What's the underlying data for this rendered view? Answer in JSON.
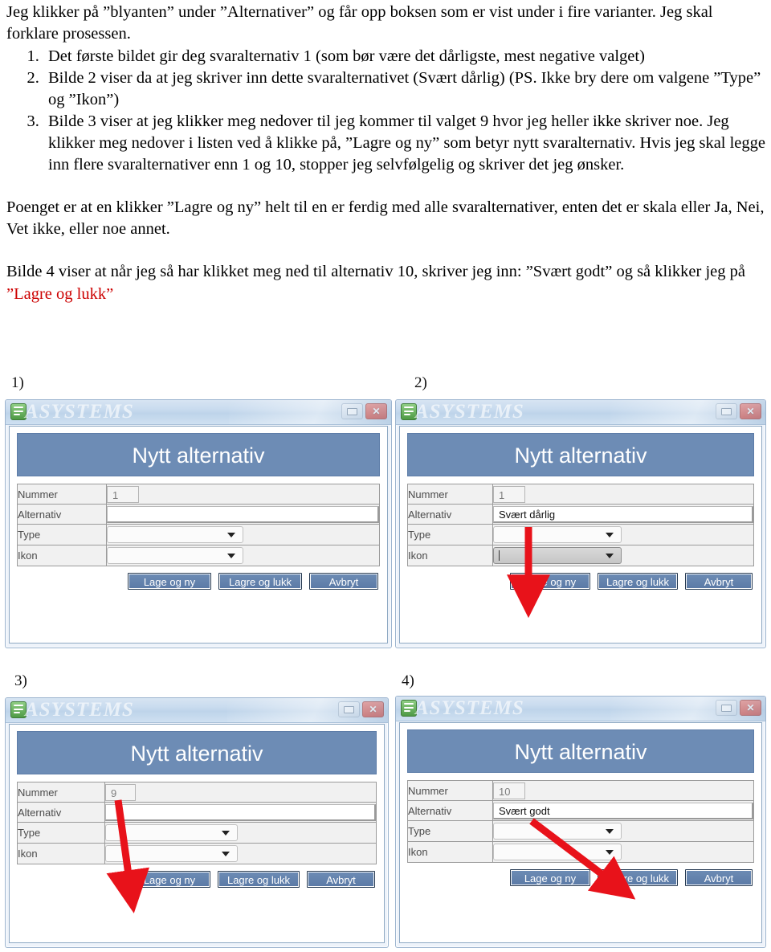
{
  "document": {
    "intro": "Jeg klikker på ”blyanten” under ”Alternativer” og får opp boksen som er vist under i fire varianter. Jeg skal forklare prosessen.",
    "steps": [
      "Det første bildet gir deg svaralternativ 1 (som bør være det dårligste, mest negative valget)",
      "Bilde 2 viser da at jeg skriver inn dette svaralternativet (Svært dårlig) (PS. Ikke bry dere om valgene ”Type” og ”Ikon”)",
      "Bilde 3 viser at jeg klikker meg nedover til jeg kommer til valget 9 hvor jeg heller ikke skriver noe. Jeg klikker meg nedover i listen ved å klikke på, ”Lagre og ny” som betyr nytt svaralternativ. Hvis jeg skal legge inn flere svaralternativer enn 1 og 10, stopper jeg selvfølgelig og skriver det jeg ønsker."
    ],
    "paragraph2": "Poenget er at en klikker ”Lagre og ny” helt til en er ferdig med alle svaralternativer, enten det er skala eller Ja, Nei, Vet ikke,  eller noe annet.",
    "paragraph3_pre": "Bilde 4 viser at når jeg så har klikket meg ned til alternativ 10, skriver jeg inn: ”Svært godt” og så klikker jeg på ",
    "paragraph3_red": "”Lagre og lukk”"
  },
  "captions": {
    "fig1": "1)",
    "fig2": "2)",
    "fig3": "3)",
    "fig4": "4)"
  },
  "dialog_common": {
    "watermark": "ASYSTEMS",
    "app_icon": "form-document-icon",
    "minimize_icon": "minimize-icon",
    "close_icon": "close-icon",
    "header_title": "Nytt alternativ",
    "labels": {
      "nummer": "Nummer",
      "alternativ": "Alternativ",
      "type": "Type",
      "ikon": "Ikon"
    },
    "buttons": {
      "save_new": "Lage og ny",
      "save_close": "Lagre og lukk",
      "cancel": "Avbryt"
    },
    "colors": {
      "header_blue": "#6d8cb5",
      "button_blue": "#5b7aa6",
      "close_red": "#cf2d21",
      "arrow_red": "#e8121a",
      "highlight_red_text": "#cc0000"
    }
  },
  "dialogs": [
    {
      "id": "dialog-1",
      "nummer_value": "1",
      "alternativ_value": "",
      "type_value": "",
      "ikon_value": "",
      "ikon_focused": false,
      "arrow": null
    },
    {
      "id": "dialog-2",
      "nummer_value": "1",
      "alternativ_value": "Svært dårlig",
      "type_value": "",
      "ikon_value": "",
      "ikon_focused": true,
      "arrow": "vertical-down-to-lage-og-ny"
    },
    {
      "id": "dialog-3",
      "nummer_value": "9",
      "alternativ_value": "",
      "type_value": "",
      "ikon_value": "",
      "ikon_focused": false,
      "arrow": "diagonal-down-to-lage-og-ny"
    },
    {
      "id": "dialog-4",
      "nummer_value": "10",
      "alternativ_value": "Svært godt",
      "type_value": "",
      "ikon_value": "",
      "ikon_focused": false,
      "arrow": "diagonal-down-to-lagre-og-lukk"
    }
  ]
}
